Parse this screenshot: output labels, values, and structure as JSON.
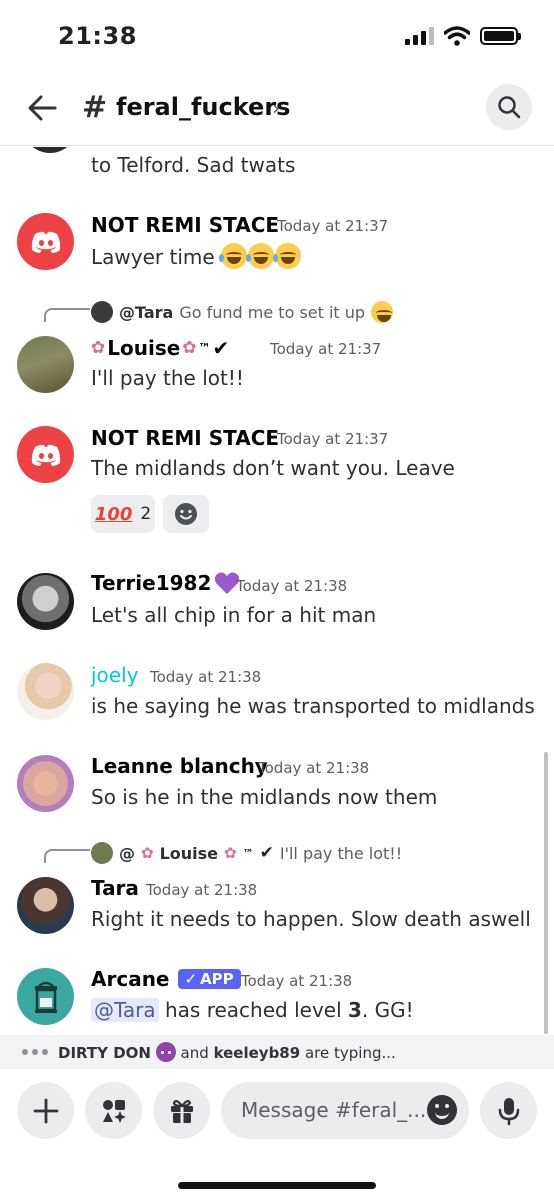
{
  "status": {
    "time": "21:38"
  },
  "header": {
    "hash": "#",
    "channel": "feral_fuckers",
    "chevron": "›"
  },
  "messages": {
    "partial": {
      "text": "to Telford. Sad twats"
    },
    "m1": {
      "author": "NOT REMI STACE",
      "timestamp": "Today at 21:37",
      "text": "Lawyer time"
    },
    "m2": {
      "reply_name": "@Tara",
      "reply_text": "Go fund me to set it up",
      "author": "Louise",
      "timestamp": "Today at 21:37",
      "text": "I'll pay the lot!!",
      "tm": "™",
      "check": "✔"
    },
    "m3": {
      "author": "NOT REMI STACE",
      "timestamp": "Today at 21:37",
      "text": "The midlands don’t want you. Leave",
      "reaction_emoji": "100",
      "reaction_count": "2"
    },
    "m4": {
      "author": "Terrie1982",
      "timestamp": "Today at 21:38",
      "text": "Let's all chip in for a hit man"
    },
    "m5": {
      "author": "joely",
      "timestamp": "Today at 21:38",
      "text": "is he saying he was transported to midlands",
      "author_color": "#00c8e6"
    },
    "m6": {
      "author": "Leanne blanchy",
      "timestamp": "Today at 21:38",
      "text": "So is he in the midlands now them"
    },
    "m7": {
      "reply_name": "@",
      "reply_name2": "Louise",
      "reply_tm": "™",
      "reply_check": "✔",
      "reply_text": "I'll pay the lot!!",
      "author": "Tara",
      "timestamp": "Today at 21:38",
      "text": "Right it needs to happen. Slow death aswell"
    },
    "m8": {
      "author": "Arcane",
      "badge": "APP",
      "badge_check": "✓",
      "timestamp": "Today at 21:38",
      "mention": "@Tara",
      "text_a": "has reached level",
      "level": "3",
      "text_b": ". GG!"
    }
  },
  "typing": {
    "user1": "DIRTY DON",
    "and": "and",
    "user2": "keeleyb89",
    "suffix": "are typing..."
  },
  "composer": {
    "placeholder": "Message #feral_..."
  },
  "colors": {
    "discord_red": "#ed4245",
    "blurple": "#5865f2",
    "arcane_teal": "#3aa8a1"
  }
}
